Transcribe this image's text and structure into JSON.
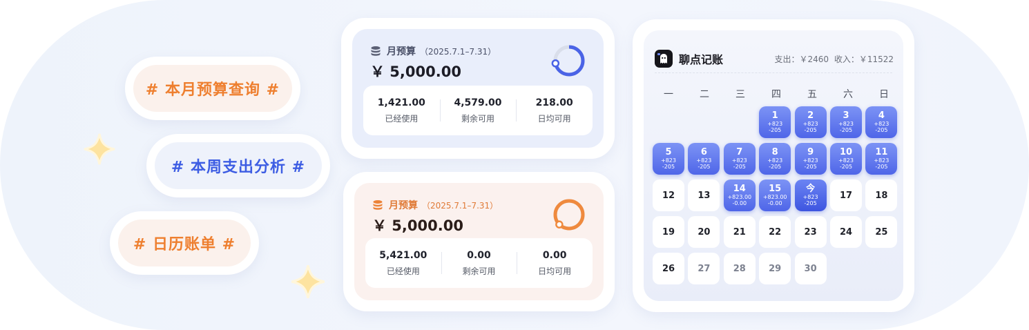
{
  "tags": [
    {
      "label": "# 本月预算查询 #",
      "tone": "orange"
    },
    {
      "label": "# 本周支出分析 #",
      "tone": "blue"
    },
    {
      "label": "# 日历账单  #",
      "tone": "orange"
    }
  ],
  "budget_cards": [
    {
      "title": "月预算",
      "range": "（2025.7.1–7.31）",
      "amount": "￥ 5,000.00",
      "ring_progress": 0.72,
      "accent": "#4a63e6",
      "stats": [
        {
          "value": "1,421.00",
          "label": "已经使用"
        },
        {
          "value": "4,579.00",
          "label": "剩余可用"
        },
        {
          "value": "218.00",
          "label": "日均可用"
        }
      ]
    },
    {
      "title": "月预算",
      "range": "（2025.7.1–7.31）",
      "amount": "￥ 5,000.00",
      "ring_progress": 1.0,
      "accent": "#ef8a3e",
      "stats": [
        {
          "value": "5,421.00",
          "label": "已经使用"
        },
        {
          "value": "0.00",
          "label": "剩余可用"
        },
        {
          "value": "0.00",
          "label": "日均可用"
        }
      ]
    }
  ],
  "calendar": {
    "app_name": "聊点记账",
    "expense_label": "支出：￥2460",
    "income_label": "收入：￥11522",
    "weekdays": [
      "一",
      "二",
      "三",
      "四",
      "五",
      "六",
      "日"
    ],
    "leading_blanks": 3,
    "days": [
      {
        "d": "1",
        "a": "+823",
        "b": "-205",
        "state": "active"
      },
      {
        "d": "2",
        "a": "+823",
        "b": "-205",
        "state": "active"
      },
      {
        "d": "3",
        "a": "+823",
        "b": "-205",
        "state": "active"
      },
      {
        "d": "4",
        "a": "+823",
        "b": "-205",
        "state": "active"
      },
      {
        "d": "5",
        "a": "+823",
        "b": "-205",
        "state": "active"
      },
      {
        "d": "6",
        "a": "+823",
        "b": "-205",
        "state": "active"
      },
      {
        "d": "7",
        "a": "+823",
        "b": "-205",
        "state": "active"
      },
      {
        "d": "8",
        "a": "+823",
        "b": "-205",
        "state": "active"
      },
      {
        "d": "9",
        "a": "+823",
        "b": "-205",
        "state": "active"
      },
      {
        "d": "10",
        "a": "+823",
        "b": "-205",
        "state": "active"
      },
      {
        "d": "11",
        "a": "+823",
        "b": "-205",
        "state": "active"
      },
      {
        "d": "12",
        "state": "white"
      },
      {
        "d": "13",
        "state": "white"
      },
      {
        "d": "14",
        "a": "+823.00",
        "b": "-0.00",
        "state": "active"
      },
      {
        "d": "15",
        "a": "+823.00",
        "b": "-0.00",
        "state": "active"
      },
      {
        "d": "今",
        "a": "+823",
        "b": "-205",
        "state": "today"
      },
      {
        "d": "17",
        "state": "white"
      },
      {
        "d": "18",
        "state": "white"
      },
      {
        "d": "19",
        "state": "white"
      },
      {
        "d": "20",
        "state": "white"
      },
      {
        "d": "21",
        "state": "white"
      },
      {
        "d": "22",
        "state": "white"
      },
      {
        "d": "23",
        "state": "white"
      },
      {
        "d": "24",
        "state": "white"
      },
      {
        "d": "25",
        "state": "white"
      },
      {
        "d": "26",
        "state": "white"
      },
      {
        "d": "27",
        "state": "dim"
      },
      {
        "d": "28",
        "state": "dim"
      },
      {
        "d": "29",
        "state": "dim"
      },
      {
        "d": "30",
        "state": "dim"
      }
    ]
  }
}
